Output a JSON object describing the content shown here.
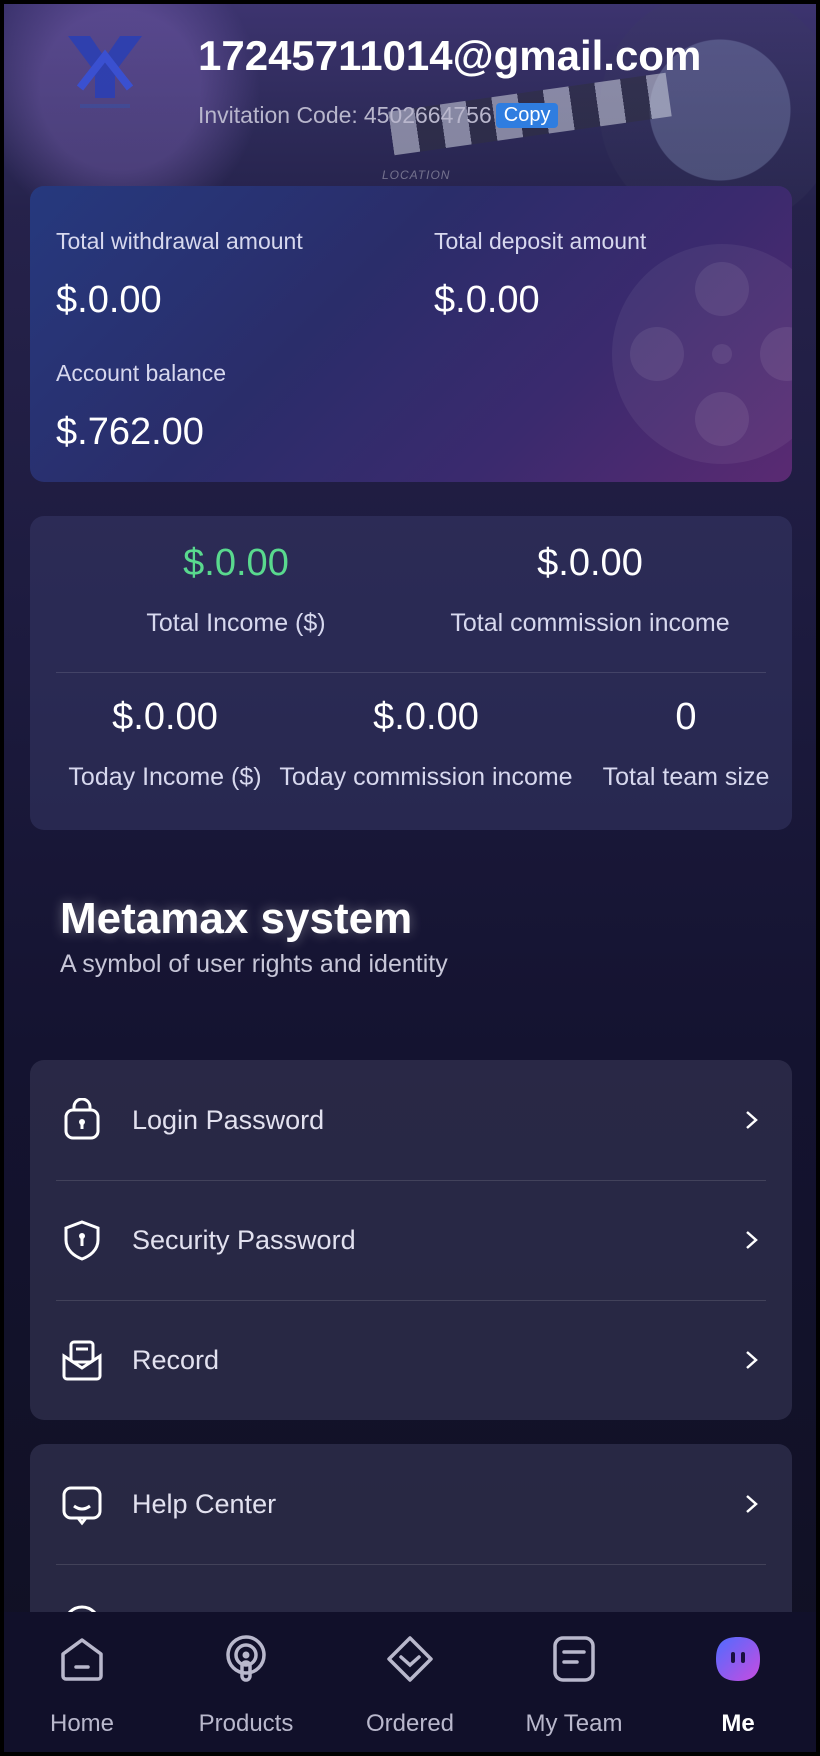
{
  "header": {
    "email": "17245711014@gmail.com",
    "invitation_label": "Invitation Code:",
    "invitation_code": "4502664756",
    "copy_label": "Copy",
    "clapper_text": "LOCATION"
  },
  "balance": {
    "withdrawal_label": "Total withdrawal amount",
    "withdrawal_value": "$.0.00",
    "deposit_label": "Total deposit amount",
    "deposit_value": "$.0.00",
    "account_label": "Account balance",
    "account_value": "$.762.00"
  },
  "stats": {
    "total_income_value": "$.0.00",
    "total_income_label": "Total Income ($)",
    "total_commission_value": "$.0.00",
    "total_commission_label": "Total commission income",
    "today_income_value": "$.0.00",
    "today_income_label": "Today Income ($)",
    "today_commission_value": "$.0.00",
    "today_commission_label": "Today commission income",
    "team_size_value": "0",
    "team_size_label": "Total team size",
    "positive_color": "#59d98e"
  },
  "system": {
    "title": "Metamax system",
    "subtitle": "A symbol of user rights and identity"
  },
  "menu": {
    "group1": [
      {
        "label": "Login Password",
        "icon": "lock-icon"
      },
      {
        "label": "Security Password",
        "icon": "shield-icon"
      },
      {
        "label": "Record",
        "icon": "record-icon"
      }
    ],
    "group2": [
      {
        "label": "Help Center",
        "icon": "help-chat-icon"
      }
    ]
  },
  "nav": [
    {
      "label": "Home",
      "icon": "home-icon",
      "active": false
    },
    {
      "label": "Products",
      "icon": "podcast-icon",
      "active": false
    },
    {
      "label": "Ordered",
      "icon": "ordered-icon",
      "active": false
    },
    {
      "label": "My Team",
      "icon": "team-doc-icon",
      "active": false
    },
    {
      "label": "Me",
      "icon": "me-icon",
      "active": true
    }
  ]
}
